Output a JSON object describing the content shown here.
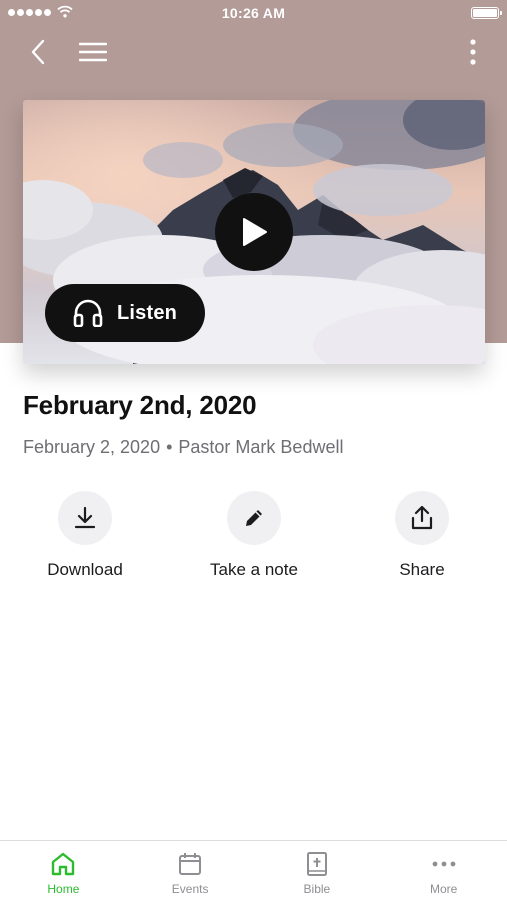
{
  "status_bar": {
    "time": "10:26 AM"
  },
  "sermon": {
    "title": "February 2nd, 2020",
    "date": "February 2, 2020",
    "separator": "•",
    "speaker": "Pastor Mark Bedwell",
    "listen_label": "Listen"
  },
  "actions": [
    {
      "label": "Download",
      "icon": "download-icon"
    },
    {
      "label": "Take a note",
      "icon": "pencil-icon"
    },
    {
      "label": "Share",
      "icon": "share-icon"
    }
  ],
  "tabs": [
    {
      "label": "Home",
      "icon": "home-icon",
      "active": true
    },
    {
      "label": "Events",
      "icon": "calendar-icon",
      "active": false
    },
    {
      "label": "Bible",
      "icon": "bible-icon",
      "active": false
    },
    {
      "label": "More",
      "icon": "more-dots-icon",
      "active": false
    }
  ],
  "colors": {
    "header_background": "#b39b97",
    "accent_active": "#2dbb2f",
    "tab_inactive": "#8e8e93",
    "button_dark": "#111111"
  }
}
